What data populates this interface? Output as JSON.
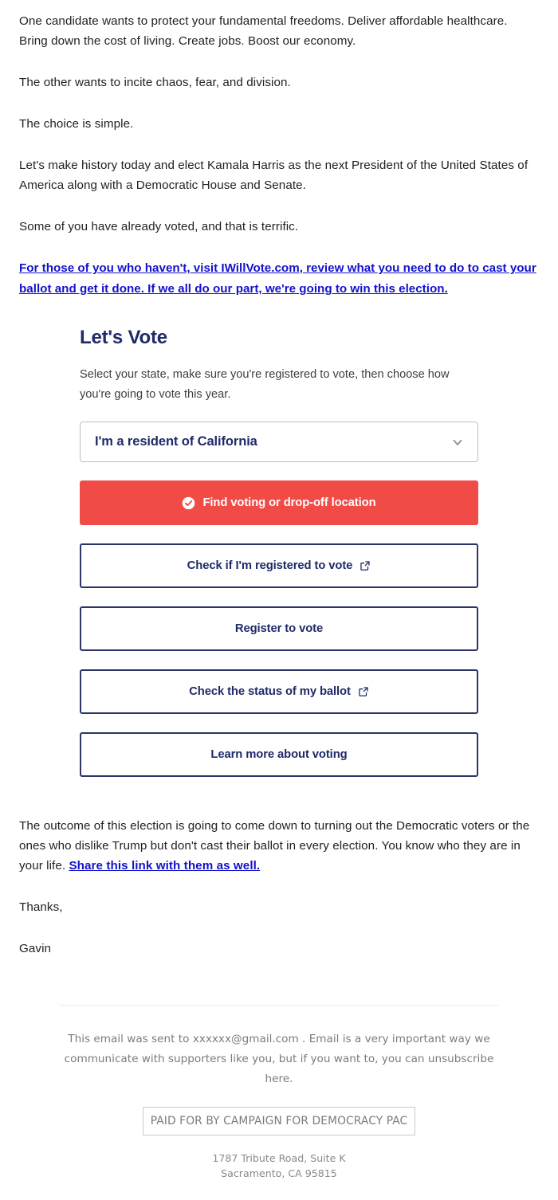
{
  "message": {
    "paragraphs": [
      "One candidate wants to protect your fundamental freedoms. Deliver affordable healthcare. Bring down the cost of living. Create jobs. Boost our economy.",
      "The other wants to incite chaos, fear, and division.",
      "The choice is simple.",
      "Let's make history today and elect Kamala Harris as the next President of the United States of America along with a Democratic House and Senate.",
      "Some of you have already voted, and that is terrific."
    ],
    "cta_link": "For those of you who haven't, visit IWillVote.com, review what you need to do to cast your ballot and get it done. If we all do our part, we're going to win this election.",
    "closing_paragraph_prefix": "The outcome of this election is going to come down to turning out the Democratic voters or the ones who dislike Trump but don't cast their ballot in every election. You know who they are in your life. ",
    "closing_link": "Share this link with them as well.",
    "signoff": "Thanks,",
    "signature": "Gavin"
  },
  "vote_widget": {
    "title": "Let's Vote",
    "subtitle": "Select your state, make sure you're registered to vote, then choose how you're going to vote this year.",
    "state_select": {
      "value": "I'm a resident of California",
      "icon": "chevron-down-icon"
    },
    "buttons": [
      {
        "label": "Find voting or drop-off location",
        "style": "primary",
        "leading_icon": "check-circle-icon",
        "trailing_icon": null
      },
      {
        "label": "Check if I'm registered to vote",
        "style": "outline",
        "leading_icon": null,
        "trailing_icon": "external-link-icon"
      },
      {
        "label": "Register to vote",
        "style": "outline",
        "leading_icon": null,
        "trailing_icon": null
      },
      {
        "label": "Check the status of my ballot",
        "style": "outline",
        "leading_icon": null,
        "trailing_icon": "external-link-icon"
      },
      {
        "label": "Learn more about voting",
        "style": "outline",
        "leading_icon": null,
        "trailing_icon": null
      }
    ]
  },
  "footer": {
    "sent_to_prefix": "This email was sent to ",
    "recipient_email": "xxxxxx@gmail.com",
    "sent_to_suffix": " . Email is a very important way we communicate with supporters like you, but if you want to, you can ",
    "unsubscribe_label": "unsubscribe here",
    "sent_to_end": ".",
    "disclaimer": "PAID FOR BY CAMPAIGN FOR DEMOCRACY PAC",
    "address_line1": "1787 Tribute Road, Suite K",
    "address_line2": "Sacramento, CA 95815"
  },
  "colors": {
    "navy": "#1f2a68",
    "red": "#f04b46",
    "link_blue": "#1212cc",
    "body_text": "#222222",
    "muted": "#7b7b7b"
  }
}
